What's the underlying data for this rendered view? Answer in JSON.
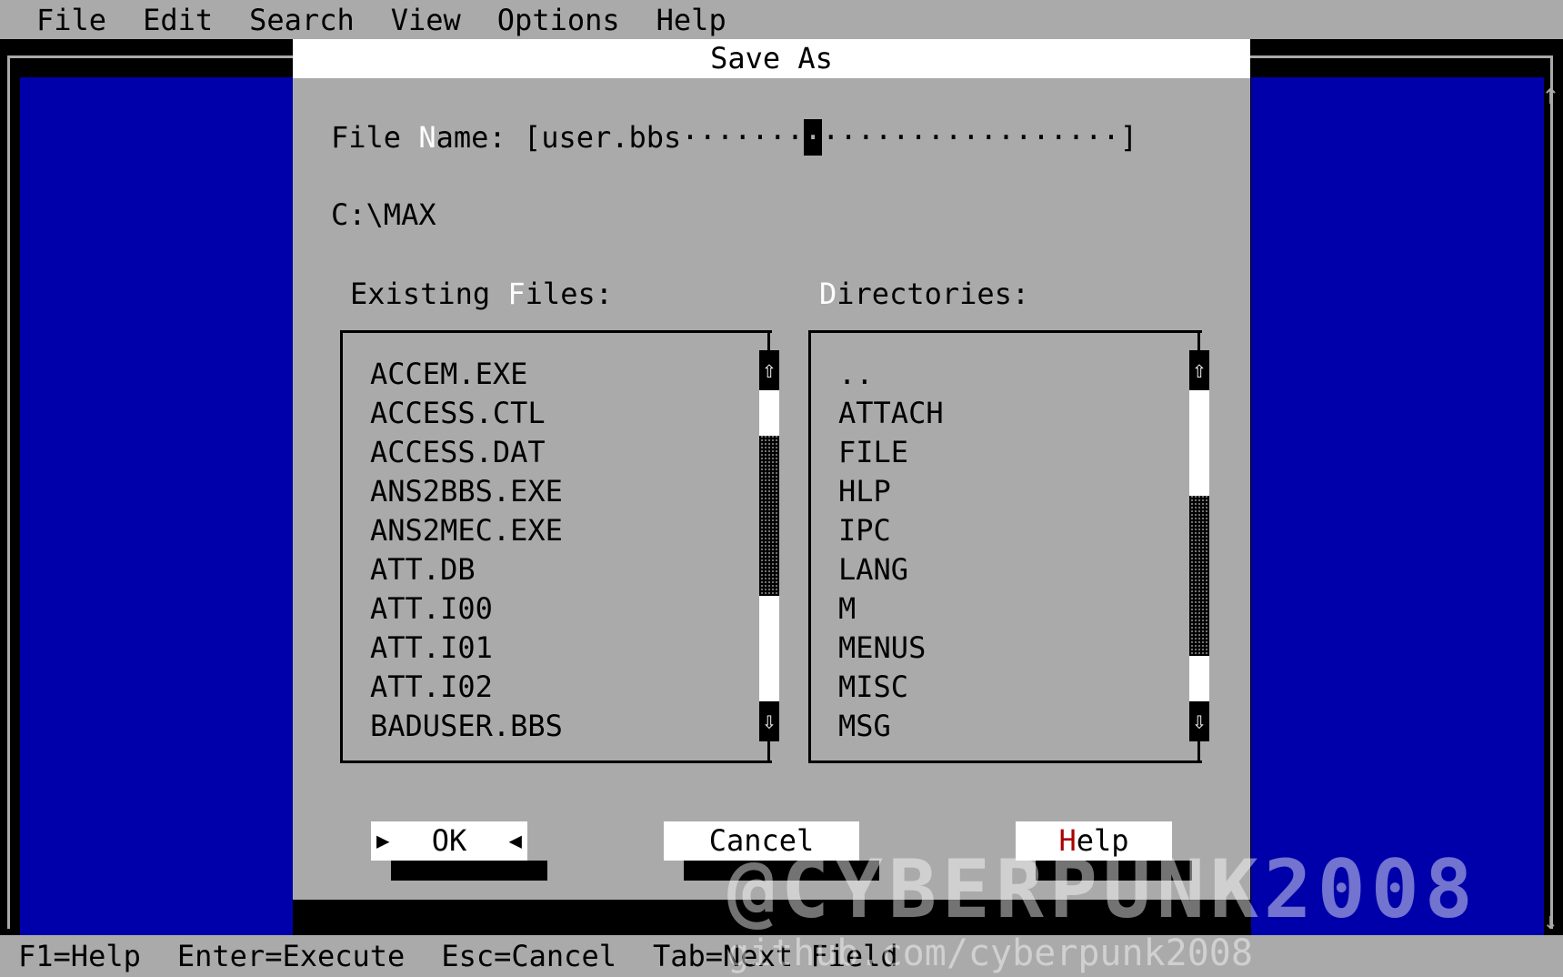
{
  "menubar": {
    "items": [
      "File",
      "Edit",
      "Search",
      "View",
      "Options",
      "Help"
    ]
  },
  "dialog": {
    "title": "Save As",
    "filename": {
      "label_pre": "File ",
      "label_hot": "N",
      "label_post": "ame: ",
      "value_pre": "[user.bbs·······",
      "cursor": "·",
      "value_post": "·················]"
    },
    "current_path": "C:\\MAX",
    "files_label": {
      "hot": "F",
      "pre": "Existing ",
      "post": "iles:"
    },
    "dirs_label": {
      "hot": "D",
      "post": "irectories:"
    },
    "files": [
      "ACCEM.EXE",
      "ACCESS.CTL",
      "ACCESS.DAT",
      "ANS2BBS.EXE",
      "ANS2MEC.EXE",
      "ATT.DB",
      "ATT.I00",
      "ATT.I01",
      "ATT.I02",
      "BADUSER.BBS"
    ],
    "directories": [
      "..",
      "ATTACH",
      "FILE",
      "HLP",
      "IPC",
      "LANG",
      "M",
      "MENUS",
      "MISC",
      "MSG"
    ],
    "files_scroll_position": 0.3,
    "dirs_scroll_position": 0.7,
    "buttons": {
      "ok": "OK",
      "cancel": "Cancel",
      "help_hot": "H",
      "help_rest": "elp"
    }
  },
  "statusbar": {
    "items": [
      "F1=Help",
      "Enter=Execute",
      "Esc=Cancel",
      "Tab=Next Field"
    ]
  },
  "watermark": {
    "text": "@CYBERPUNK2008",
    "url": "github.com/cyberpunk2008"
  },
  "colors": {
    "desktop_blue": "#0000aa",
    "dialog_gray": "#aaaaaa",
    "hotkey_white": "#ffffff",
    "hotkey_red": "#aa0000"
  },
  "icons": {
    "scroll_up": "arrow-up-icon",
    "scroll_down": "arrow-down-icon"
  }
}
